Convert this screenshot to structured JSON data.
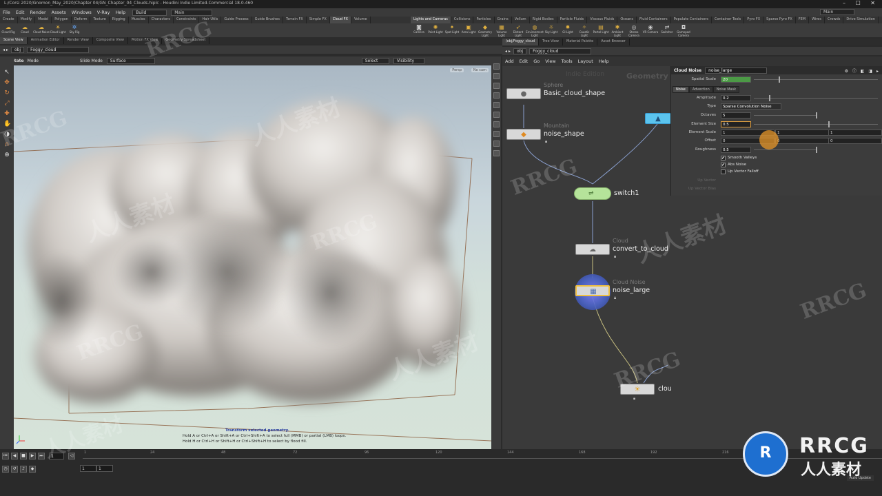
{
  "window": {
    "title": "L:/Corsi 2020/Gnomon_May_2020/Chapter 04/GN_Chapter_04_Clouds.hiplc - Houdini Indie Limited-Commercial 18.0.460"
  },
  "menu": [
    "File",
    "Edit",
    "Render",
    "Assets",
    "Windows",
    "V-Ray",
    "Help"
  ],
  "desktop": {
    "build": "Build",
    "main": "Main",
    "right_main": "Main"
  },
  "shelf_left": {
    "tabs": [
      "Create",
      "Modify",
      "Model",
      "Polygon",
      "Deform",
      "Texture",
      "Rigging",
      "Muscles",
      "Characters",
      "Constraints",
      "Hair Utils",
      "Guide Process",
      "Guide Brushes",
      "Terrain FX",
      "Simple FX",
      "Cloud FX",
      "Volume"
    ],
    "active_tab": "Cloud FX",
    "tools": [
      "Cloud Rig",
      "Cloud",
      "Cloud Noise",
      "Cloud Light",
      "Sky Rig"
    ]
  },
  "shelf_right": {
    "tabs": [
      "Lights and Cameras",
      "Collisions",
      "Particles",
      "Grains",
      "Vellum",
      "Rigid Bodies",
      "Particle Fluids",
      "Viscous Fluids",
      "Oceans",
      "Fluid Containers",
      "Populate Containers",
      "Container Tools",
      "Pyro FX",
      "Sparse Pyro FX",
      "FEM",
      "Wires",
      "Crowds",
      "Drive Simulation"
    ],
    "tools": [
      "Camera",
      "Point Light",
      "Spot Light",
      "Area Light",
      "Geometry Light",
      "Volume Light",
      "Distant Light",
      "Environment Light",
      "Sky Light",
      "GI Light",
      "Caustic Light",
      "Portal Light",
      "Ambient Light",
      "Stereo Camera",
      "VR Camera",
      "Switcher",
      "Gamepad Camera"
    ]
  },
  "left_pane": {
    "tabs": [
      "Scene View",
      "Animation Editor",
      "Render View",
      "Composite View",
      "Motion FX View",
      "Geometry Spreadsheet"
    ],
    "path": [
      "obj",
      "Foggy_cloud"
    ],
    "toolbar": {
      "tool": "Rotate",
      "mode": "Mode",
      "slide_mode": "Slide Mode",
      "surface": "Surface",
      "select": "Select",
      "visibility": "Visibility"
    },
    "camera": {
      "persp": "Persp",
      "cam": "No cam"
    },
    "hint": {
      "title": "Transform selected geometry.",
      "line1": "Hold A or Ctrl+A or Shift+A or Ctrl+Shift+A to select full (MMB) or partial (LMB) loops.",
      "line2": "Hold H or Ctrl+H or Shift+H or Ctrl+Shift+H to select by flood fill."
    }
  },
  "right_pane": {
    "tabs": [
      "/obj/Foggy_cloud",
      "Tree View",
      "Material Palette",
      "Asset Browser"
    ],
    "path": [
      "obj",
      "Foggy_cloud"
    ],
    "menu": [
      "Add",
      "Edit",
      "Go",
      "View",
      "Tools",
      "Layout",
      "Help"
    ],
    "watermark": "Indie Edition",
    "context": "Geometry"
  },
  "nodes": [
    {
      "id": "sphere",
      "type": "Sphere",
      "name": "Basic_cloud_shape",
      "icon": "sphere-icon"
    },
    {
      "id": "mountain",
      "type": "Mountain",
      "name": "noise_shape",
      "icon": "mountain-icon"
    },
    {
      "id": "switch",
      "type": "",
      "name": "switch1",
      "icon": "switch-icon"
    },
    {
      "id": "cloud",
      "type": "Cloud",
      "name": "convert_to_cloud",
      "icon": "cloud-icon"
    },
    {
      "id": "noise",
      "type": "Cloud Noise",
      "name": "noise_large",
      "icon": "cloud-noise-icon"
    },
    {
      "id": "cloud2",
      "type": "",
      "name": "clou",
      "icon": "cloud-light-icon"
    }
  ],
  "params": {
    "node_type": "Cloud Noise",
    "node_name": "noise_large",
    "spatial_scale_label": "Spatial Scale",
    "spatial_scale": "20",
    "tabs": [
      "Noise",
      "Advection",
      "Noise Mask"
    ],
    "amplitude_label": "Amplitude",
    "amplitude": "0.2",
    "type_label": "Type",
    "type": "Sparse Convolution Noise",
    "octaves_label": "Octaves",
    "octaves": "5",
    "element_size_label": "Element Size",
    "element_size": "0.5",
    "element_scale_label": "Element Scale",
    "element_scale": [
      "1",
      "1",
      "1"
    ],
    "offset_label": "Offset",
    "offset": [
      "0",
      "0",
      "0"
    ],
    "roughness_label": "Roughness",
    "roughness": "0.5",
    "smooth_valleys": "Smooth Valleys",
    "abs_noise": "Abs Noise",
    "up_vector_falloff": "Up Vector Falloff",
    "up_vector": "Up Vector",
    "up_vector_bias": "Up Vector Bias"
  },
  "timeline": {
    "frame": "1",
    "range_start": "1",
    "range_end": "1",
    "ticks": [
      "1",
      "24",
      "48",
      "72",
      "96",
      "120",
      "144",
      "168",
      "192",
      "216"
    ],
    "auto_update": "Auto Update"
  },
  "watermarks": {
    "rrcg": "RRCG",
    "cn": "人人素材"
  }
}
